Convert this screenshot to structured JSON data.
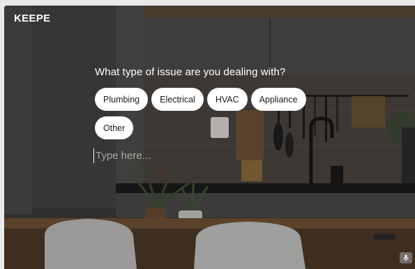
{
  "brand": {
    "logo": "KEEPE"
  },
  "prompt": {
    "question": "What type of issue are you dealing with?",
    "options": [
      "Plumbing",
      "Electrical",
      "HVAC",
      "Appliance",
      "Other"
    ]
  },
  "answer": {
    "placeholder": "Type here...",
    "value": ""
  },
  "icons": {
    "mic": "microphone-icon"
  }
}
